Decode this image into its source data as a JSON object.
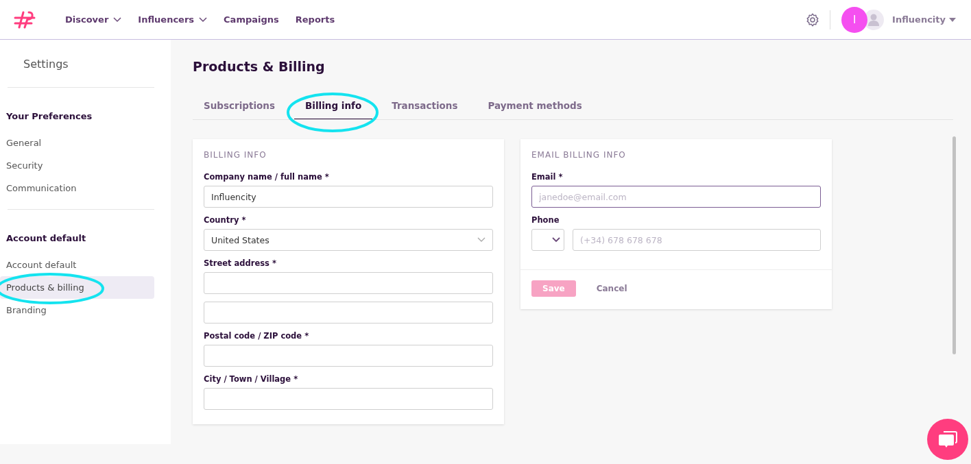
{
  "nav": {
    "items": [
      {
        "label": "Discover",
        "dropdown": true
      },
      {
        "label": "Influencers",
        "dropdown": true
      },
      {
        "label": "Campaigns",
        "dropdown": false
      },
      {
        "label": "Reports",
        "dropdown": false
      }
    ],
    "avatar_initial": "I",
    "account": "Influencity"
  },
  "sidebar": {
    "title": "Settings",
    "sections": [
      {
        "heading": "Your Preferences",
        "items": [
          {
            "label": "General",
            "selected": false
          },
          {
            "label": "Security",
            "selected": false
          },
          {
            "label": "Communication",
            "selected": false
          }
        ]
      },
      {
        "heading": "Account default",
        "items": [
          {
            "label": "Account default",
            "selected": false
          },
          {
            "label": "Products & billing",
            "selected": true,
            "highlighted": true
          },
          {
            "label": "Branding",
            "selected": false
          }
        ]
      }
    ]
  },
  "page_title": "Products & Billing",
  "tabs": [
    {
      "label": "Subscriptions",
      "selected": false,
      "highlighted": false
    },
    {
      "label": "Billing info",
      "selected": true,
      "highlighted": true
    },
    {
      "label": "Transactions",
      "selected": false,
      "highlighted": false
    },
    {
      "label": "Payment methods",
      "selected": false,
      "highlighted": false
    }
  ],
  "billing_card": {
    "heading": "BILLING INFO",
    "fields": [
      {
        "label": "Company name / full name *",
        "kind": "text",
        "value": "Influencity"
      },
      {
        "label": "Country *",
        "kind": "select",
        "value": "United States"
      },
      {
        "label": "Street address *",
        "kind": "text"
      },
      {
        "kind": "text"
      },
      {
        "label": "Postal code / ZIP code *",
        "kind": "text"
      },
      {
        "label": "City / Town / Village *",
        "kind": "text"
      }
    ]
  },
  "email_card": {
    "heading": "EMAIL BILLING INFO",
    "email_label": "Email *",
    "email_placeholder": "janedoe@email.com",
    "phone_label": "Phone",
    "phone_placeholder": "(+34) 678 678 678",
    "save": {
      "label": "Save",
      "disabled": true
    },
    "cancel": "Cancel"
  }
}
